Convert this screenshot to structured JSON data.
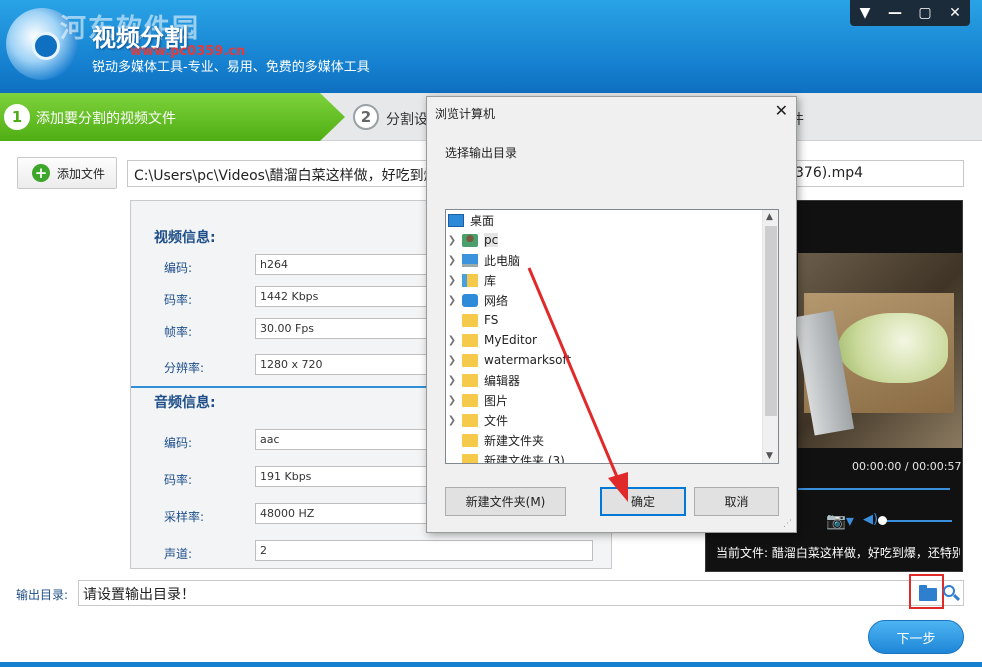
{
  "header": {
    "watermark": "河东软件园",
    "title": "视频分割",
    "watermark_url": "www.pc0359.cn",
    "subtitle": "锐动多媒体工具-专业、易用、免费的多媒体工具",
    "window_controls": [
      "▼",
      "—",
      "▢",
      "✕"
    ]
  },
  "steps": [
    {
      "number": "1",
      "label": "添加要分割的视频文件"
    },
    {
      "number": "2",
      "label": "分割设"
    },
    {
      "label": "件"
    }
  ],
  "toolbar": {
    "add_file_label": "添加文件",
    "add_file_icon": "+",
    "file_path": "C:\\Users\\pc\\Videos\\醋溜白菜这样做，好吃到爆，",
    "file_path_end": "376).mp4"
  },
  "video_info": {
    "title": "视频信息:",
    "fields": [
      {
        "label": "编码:",
        "value": "h264"
      },
      {
        "label": "码率:",
        "value": "1442 Kbps"
      },
      {
        "label": "帧率:",
        "value": "30.00 Fps"
      },
      {
        "label": "分辨率:",
        "value": "1280 x 720"
      }
    ]
  },
  "audio_info": {
    "title": "音频信息:",
    "fields": [
      {
        "label": "编码:",
        "value": "aac"
      },
      {
        "label": "码率:",
        "value": "191 Kbps"
      },
      {
        "label": "采样率:",
        "value": "48000 HZ"
      },
      {
        "label": "声道:",
        "value": "2"
      }
    ]
  },
  "preview": {
    "timecode": "00:00:00 / 00:00:57",
    "current_file": "当前文件: 醋溜白菜这样做，好吃到爆，还特别",
    "camera_icon": "📷▾",
    "volume_icon": "◀)"
  },
  "output": {
    "label": "输出目录:",
    "placeholder": "请设置输出目录！",
    "next_label": "下一步"
  },
  "dialog": {
    "title": "浏览计算机",
    "close": "✕",
    "prompt": "选择输出目录",
    "tree": [
      {
        "label": "桌面",
        "icon": "desktop-icon",
        "expandable": false
      },
      {
        "label": "pc",
        "icon": "user-icon",
        "expandable": true
      },
      {
        "label": "此电脑",
        "icon": "computer-icon",
        "expandable": true
      },
      {
        "label": "库",
        "icon": "library-icon",
        "expandable": true
      },
      {
        "label": "网络",
        "icon": "network-icon",
        "expandable": true
      },
      {
        "label": "FS",
        "icon": "folder-icon",
        "expandable": false
      },
      {
        "label": "MyEditor",
        "icon": "folder-icon",
        "expandable": true
      },
      {
        "label": "watermarksoft",
        "icon": "folder-icon",
        "expandable": true
      },
      {
        "label": "编辑器",
        "icon": "folder-icon",
        "expandable": true
      },
      {
        "label": "图片",
        "icon": "folder-icon",
        "expandable": true
      },
      {
        "label": "文件",
        "icon": "folder-icon",
        "expandable": true
      },
      {
        "label": "新建文件夹",
        "icon": "folder-icon",
        "expandable": false
      },
      {
        "label": "新建文件夹 (3)",
        "icon": "folder-icon",
        "expandable": false
      }
    ],
    "new_folder_label": "新建文件夹(M)",
    "ok_label": "确定",
    "cancel_label": "取消"
  },
  "colors": {
    "header_blue": "#1580cf",
    "step_green": "#4fae13",
    "label_blue": "#1f4f8a",
    "annotation_red": "#e02a2a"
  }
}
